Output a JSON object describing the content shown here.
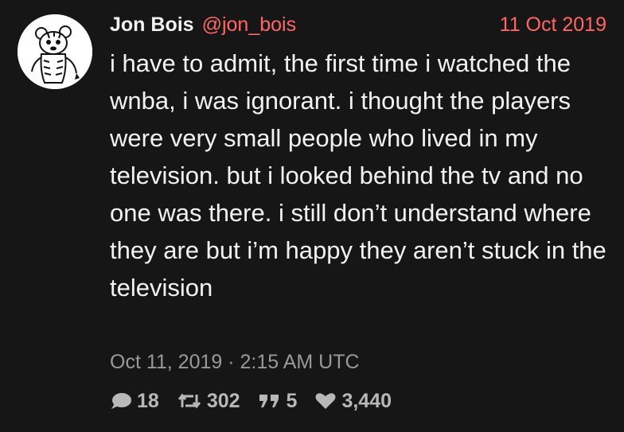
{
  "tweet": {
    "author": {
      "fullname": "Jon Bois",
      "username": "@jon_bois",
      "avatar_icon": "cartoon-tiger-avatar"
    },
    "date": "11 Oct 2019",
    "content": "i have to admit, the first time i watched the wnba, i was ignorant. i thought the players were very small people who lived in my television. but i looked behind the tv and no one was there. i still don’t understand where they are but i’m happy they aren’t stuck in the television",
    "published": "Oct 11, 2019 · 2:15 AM UTC",
    "stats": {
      "replies": "18",
      "retweets": "302",
      "quotes": "5",
      "likes": "3,440"
    }
  },
  "colors": {
    "background": "#161616",
    "text": "#f2f2f2",
    "accent": "#ff6666",
    "muted": "#999999",
    "stat": "#b8b8b8"
  }
}
